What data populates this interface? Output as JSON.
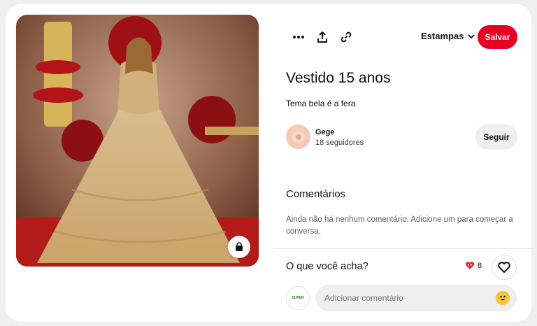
{
  "pin": {
    "title": "Vestido 15 anos",
    "description": "Tema bela é a fera"
  },
  "toolbar": {
    "more_icon": "more-options-icon",
    "share_icon": "upload-share-icon",
    "link_icon": "link-icon",
    "board_label": "Estampas",
    "save_label": "Salvar"
  },
  "creator": {
    "name": "Gege",
    "followers": "18 seguidores",
    "follow_label": "Seguir"
  },
  "comments": {
    "title": "Comentários",
    "empty_text": "Ainda não há nenhum comentário. Adicione um para começar a conversa."
  },
  "footer": {
    "prompt": "O que você acha?",
    "reaction_count": "8",
    "input_placeholder": "Adicionar comentário",
    "user_avatar_text": "SUPER"
  },
  "colors": {
    "accent": "#e60023",
    "card": "#ffffff",
    "background": "#efefef"
  }
}
